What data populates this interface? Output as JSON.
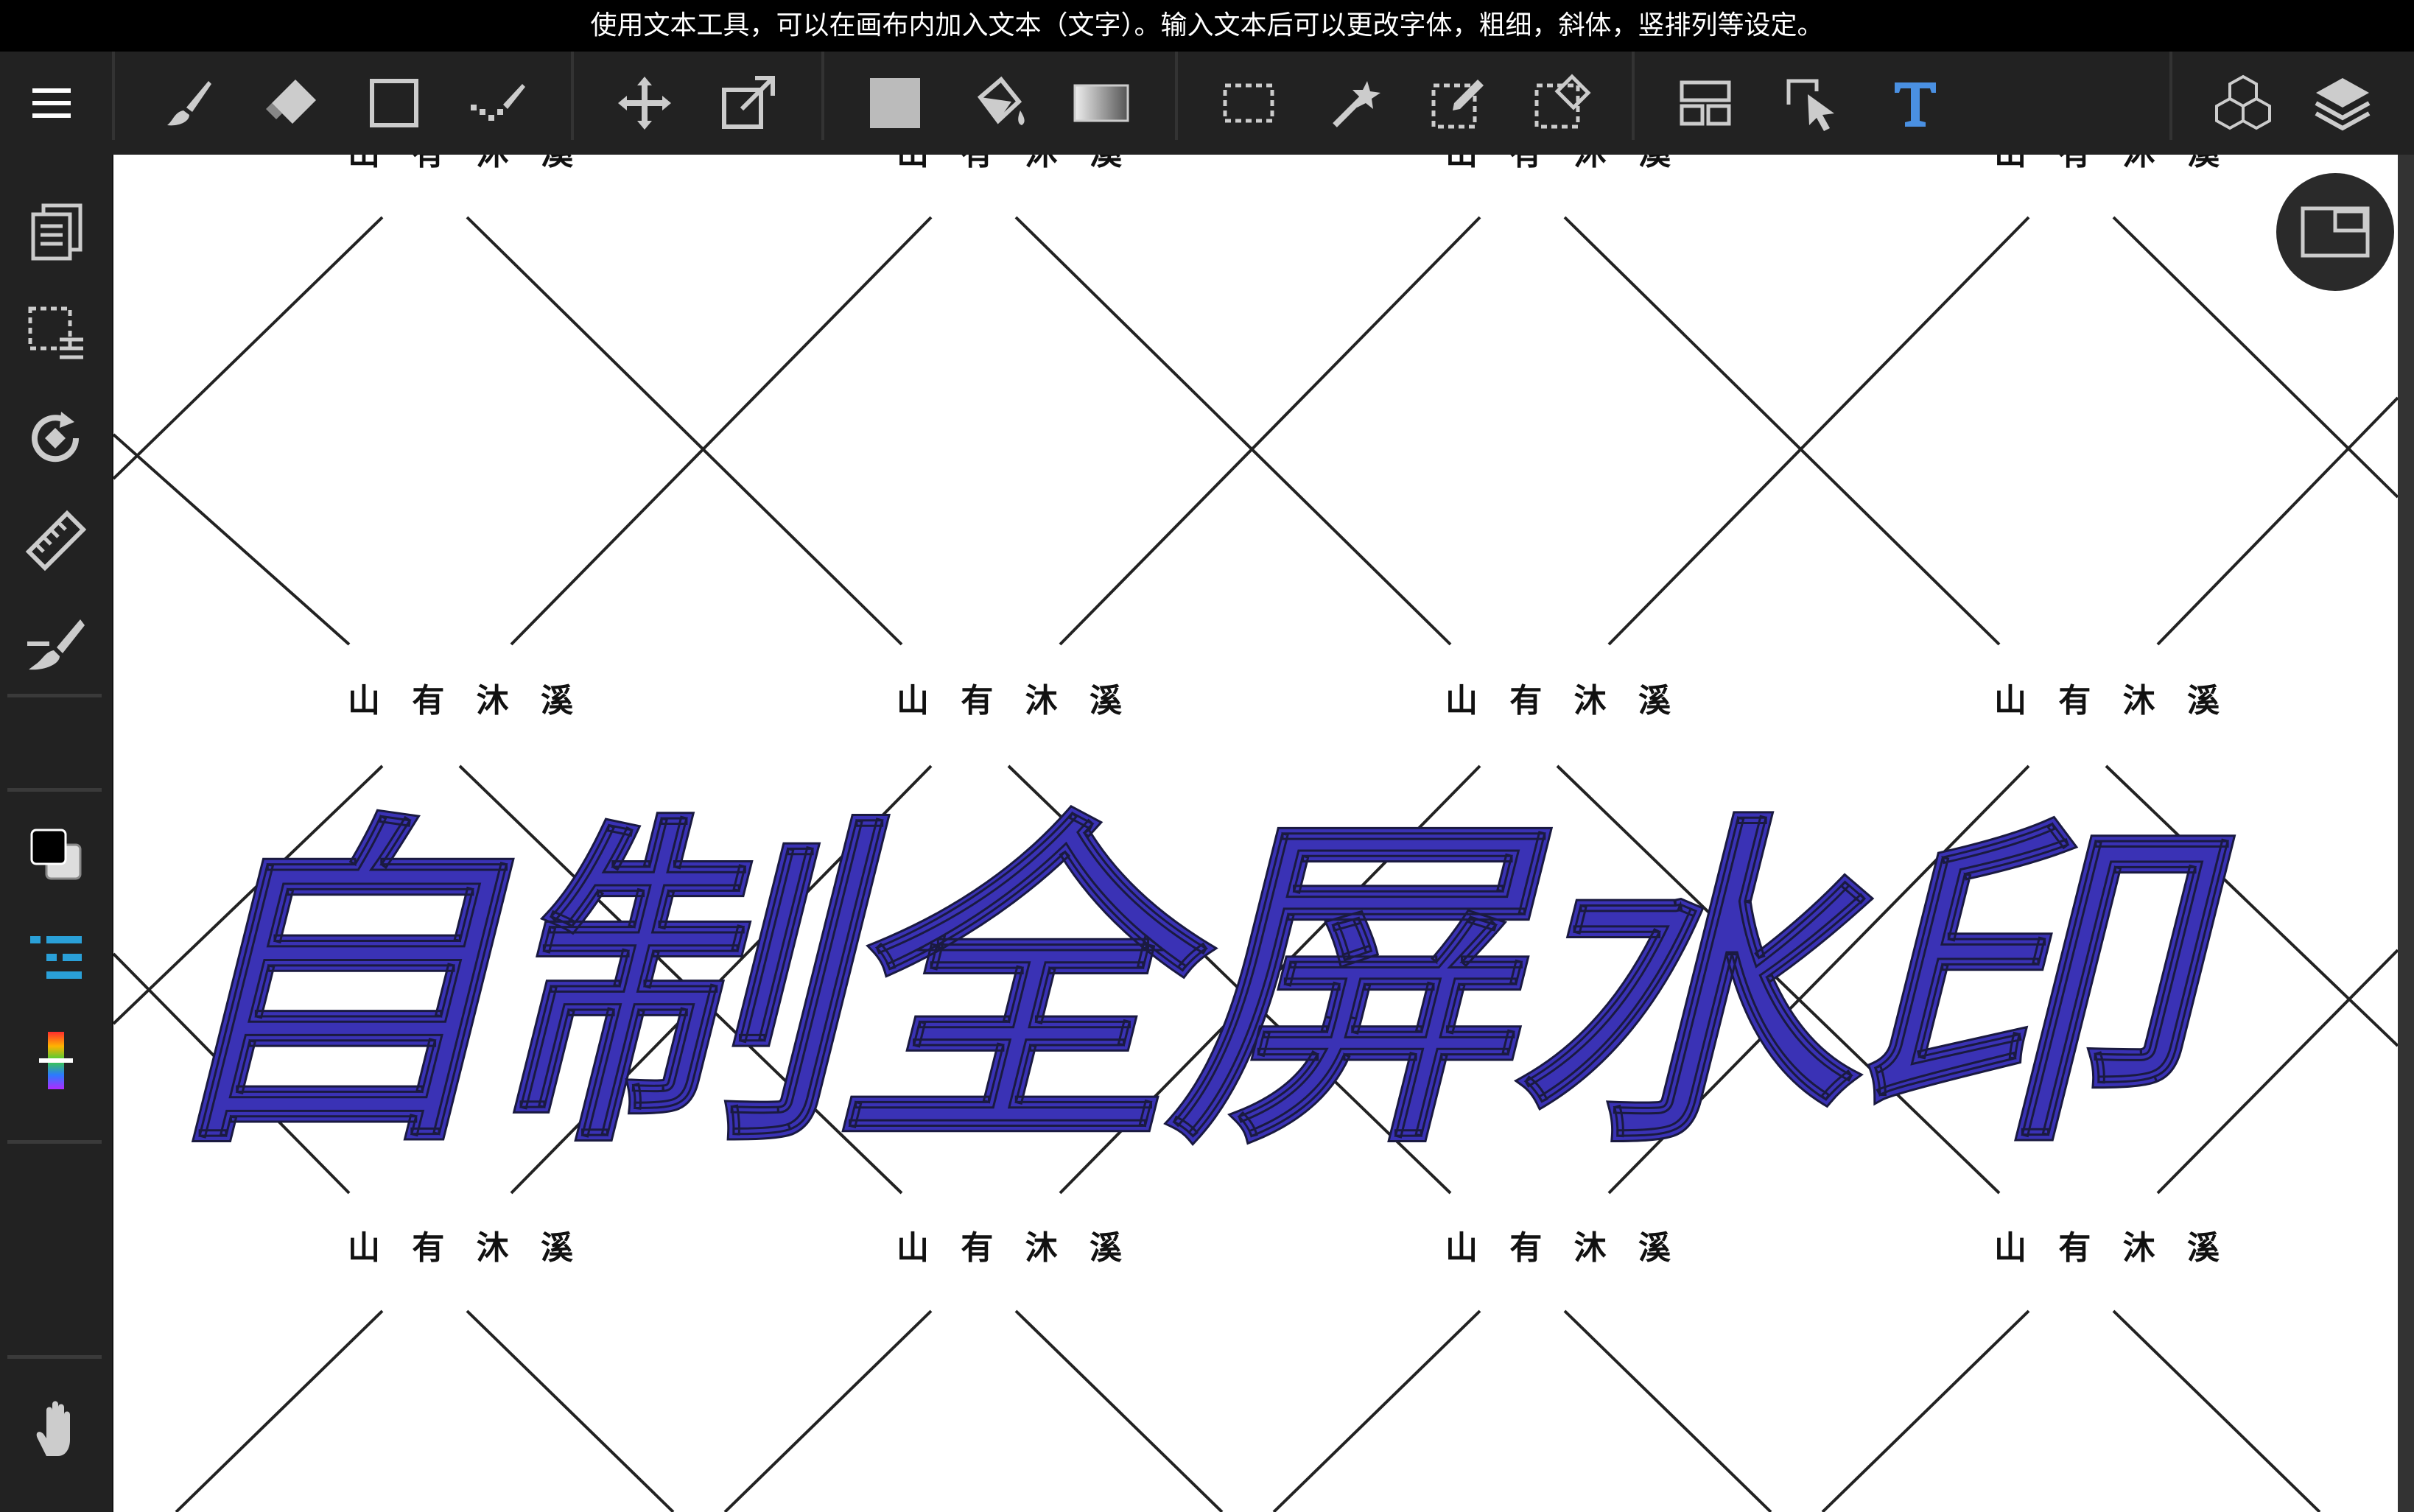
{
  "hint": "使用文本工具，可以在画布内加入文本（文字）。输入文本后可以更改字体，粗细，斜体，竖排列等设定。",
  "toolbar": {
    "tools": [
      {
        "name": "menu-icon",
        "selected": false
      },
      {
        "name": "brush-icon",
        "selected": false
      },
      {
        "name": "eraser-icon",
        "selected": false
      },
      {
        "name": "shape-icon",
        "selected": false
      },
      {
        "name": "smudge-icon",
        "selected": false
      },
      {
        "name": "move-icon",
        "selected": false
      },
      {
        "name": "transform-icon",
        "selected": false
      },
      {
        "name": "fill-color-icon",
        "selected": false
      },
      {
        "name": "bucket-icon",
        "selected": false
      },
      {
        "name": "gradient-icon",
        "selected": false
      },
      {
        "name": "select-rect-icon",
        "selected": false
      },
      {
        "name": "magic-wand-icon",
        "selected": false
      },
      {
        "name": "select-pen-icon",
        "selected": false
      },
      {
        "name": "select-eraser-icon",
        "selected": false
      },
      {
        "name": "frame-divider-icon",
        "selected": false
      },
      {
        "name": "operation-icon",
        "selected": false
      },
      {
        "name": "text-icon",
        "selected": true
      },
      {
        "name": "materials-icon",
        "selected": false
      },
      {
        "name": "layers-icon",
        "selected": false
      }
    ]
  },
  "sidebar": {
    "items": [
      "pages-icon",
      "select-layer-icon",
      "rotate-icon",
      "ruler-icon",
      "snap-icon",
      "color-icon",
      "brush-settings-icon",
      "color-bar-icon",
      "hand-icon"
    ]
  },
  "canvas": {
    "watermark_label": "山 有 沐 溪",
    "title": "自制全屏水印"
  },
  "colors": {
    "accent": "#4a90e2",
    "title_fill": "#3a32b5",
    "background": "#222222"
  }
}
